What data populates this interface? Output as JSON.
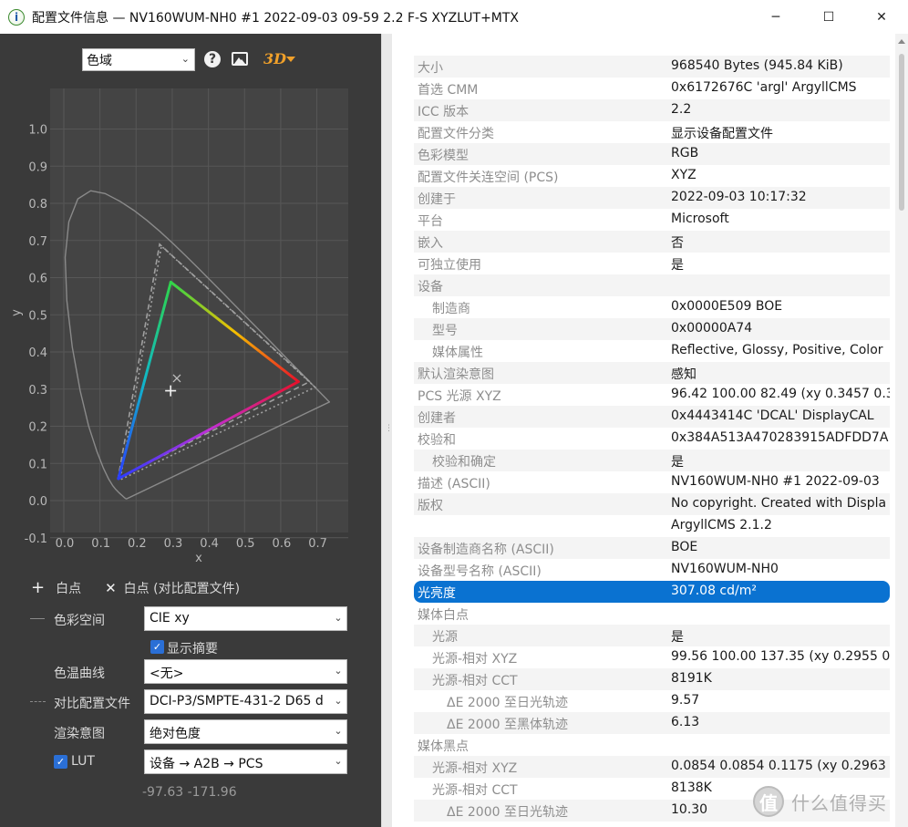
{
  "window": {
    "title": "配置文件信息 — NV160WUM-NH0 #1 2022-09-03 09-59 2.2 F-S XYZLUT+MTX",
    "app_icon": "info-icon",
    "controls": {
      "minimize": "─",
      "maximize": "☐",
      "close": "✕"
    }
  },
  "toolbar": {
    "view_select": "色域",
    "help_icon": "?",
    "threed_label": "3D"
  },
  "chart_data": {
    "type": "scatter",
    "title": "",
    "xlabel": "x",
    "ylabel": "y",
    "xlim": [
      -0.05,
      0.78
    ],
    "ylim": [
      -0.15,
      1.02
    ],
    "xticks": [
      "0.0",
      "0.1",
      "0.2",
      "0.3",
      "0.4",
      "0.5",
      "0.6",
      "0.7"
    ],
    "xtick_values": [
      0.0,
      0.1,
      0.2,
      0.3,
      0.4,
      0.5,
      0.6,
      0.7
    ],
    "yticks": [
      "1.0",
      "0.9",
      "0.8",
      "0.7",
      "0.6",
      "0.5",
      "0.4",
      "0.3",
      "0.2",
      "0.1",
      "0.0",
      "-0.1"
    ],
    "ytick_values": [
      1.0,
      0.9,
      0.8,
      0.7,
      0.6,
      0.5,
      0.4,
      0.3,
      0.2,
      0.1,
      0.0,
      -0.1
    ],
    "grid": true,
    "spectral_locus": [
      [
        0.1741,
        0.005
      ],
      [
        0.1738,
        0.0049
      ],
      [
        0.1736,
        0.0049
      ],
      [
        0.1733,
        0.0048
      ],
      [
        0.173,
        0.0048
      ],
      [
        0.1726,
        0.0048
      ],
      [
        0.1721,
        0.0048
      ],
      [
        0.1714,
        0.0051
      ],
      [
        0.1703,
        0.0058
      ],
      [
        0.1689,
        0.0069
      ],
      [
        0.1669,
        0.0086
      ],
      [
        0.1644,
        0.0109
      ],
      [
        0.1611,
        0.0138
      ],
      [
        0.1566,
        0.0177
      ],
      [
        0.151,
        0.0227
      ],
      [
        0.144,
        0.0297
      ],
      [
        0.1355,
        0.0399
      ],
      [
        0.1241,
        0.0578
      ],
      [
        0.1096,
        0.0868
      ],
      [
        0.0913,
        0.1327
      ],
      [
        0.0687,
        0.2007
      ],
      [
        0.0454,
        0.295
      ],
      [
        0.0235,
        0.4127
      ],
      [
        0.0082,
        0.5384
      ],
      [
        0.0039,
        0.6548
      ],
      [
        0.0139,
        0.7502
      ],
      [
        0.0389,
        0.812
      ],
      [
        0.0743,
        0.8338
      ],
      [
        0.1142,
        0.8262
      ],
      [
        0.1547,
        0.8059
      ],
      [
        0.1929,
        0.7816
      ],
      [
        0.2296,
        0.7543
      ],
      [
        0.2658,
        0.7243
      ],
      [
        0.3016,
        0.6923
      ],
      [
        0.3373,
        0.6589
      ],
      [
        0.3731,
        0.6245
      ],
      [
        0.4087,
        0.5896
      ],
      [
        0.4441,
        0.5547
      ],
      [
        0.4788,
        0.5202
      ],
      [
        0.5125,
        0.4866
      ],
      [
        0.5448,
        0.4544
      ],
      [
        0.5752,
        0.4242
      ],
      [
        0.6029,
        0.3965
      ],
      [
        0.627,
        0.3725
      ],
      [
        0.6482,
        0.3514
      ],
      [
        0.6658,
        0.334
      ],
      [
        0.6801,
        0.3197
      ],
      [
        0.6915,
        0.3083
      ],
      [
        0.7006,
        0.2993
      ],
      [
        0.7079,
        0.292
      ],
      [
        0.714,
        0.2859
      ],
      [
        0.719,
        0.2809
      ],
      [
        0.723,
        0.277
      ],
      [
        0.726,
        0.274
      ],
      [
        0.7283,
        0.2717
      ],
      [
        0.73,
        0.27
      ],
      [
        0.7311,
        0.2689
      ],
      [
        0.732,
        0.268
      ],
      [
        0.7327,
        0.2673
      ],
      [
        0.7334,
        0.2666
      ],
      [
        0.734,
        0.266
      ],
      [
        0.7344,
        0.2656
      ],
      [
        0.7346,
        0.2654
      ],
      [
        0.7347,
        0.2653
      ]
    ],
    "series": [
      {
        "name": "",
        "kind": "profile-gamut",
        "style": "gradient-solid",
        "points": [
          [
            0.649,
            0.32
          ],
          [
            0.296,
            0.588
          ],
          [
            0.151,
            0.059
          ]
        ]
      },
      {
        "name": "",
        "kind": "reference-gamut",
        "style": "dashed",
        "points": [
          [
            0.68,
            0.32
          ],
          [
            0.265,
            0.69
          ],
          [
            0.15,
            0.06
          ]
        ]
      },
      {
        "name": "",
        "kind": "reference-gamut-outline",
        "style": "dotted",
        "points": [
          [
            0.695,
            0.305
          ],
          [
            0.27,
            0.685
          ],
          [
            0.156,
            0.056
          ]
        ]
      }
    ],
    "whitepoint": {
      "x": 0.2955,
      "y": 0.2955
    },
    "reference_whitepoint": {
      "x": 0.3127,
      "y": 0.329
    }
  },
  "legend": {
    "whitepoint_label": "白点",
    "ref_whitepoint_label": "白点 (对比配置文件)"
  },
  "controls": {
    "colorspace_label": "色彩空间",
    "colorspace_value": "CIE xy",
    "show_summary_label": "显示摘要",
    "cct_label": "色温曲线",
    "cct_value": "<无>",
    "compare_label": "对比配置文件",
    "compare_value": "DCI-P3/SMPTE-431-2 D65 d",
    "intent_label": "渲染意图",
    "intent_value": "绝对色度",
    "lut_label": "LUT",
    "lut_value": "设备 → A2B → PCS",
    "cursor_coords": "-97.63 -171.96"
  },
  "info_rows": [
    {
      "key": "大小",
      "value": "968540 Bytes (945.84 KiB)",
      "indent": 0
    },
    {
      "key": "首选 CMM",
      "value": "0x6172676C 'argl' ArgyllCMS",
      "indent": 0
    },
    {
      "key": "ICC 版本",
      "value": "2.2",
      "indent": 0
    },
    {
      "key": "配置文件分类",
      "value": "显示设备配置文件",
      "indent": 0
    },
    {
      "key": "色彩模型",
      "value": "RGB",
      "indent": 0
    },
    {
      "key": "配置文件关连空间 (PCS)",
      "value": "XYZ",
      "indent": 0
    },
    {
      "key": "创建于",
      "value": "2022-09-03 10:17:32",
      "indent": 0
    },
    {
      "key": "平台",
      "value": "Microsoft",
      "indent": 0
    },
    {
      "key": "嵌入",
      "value": "否",
      "indent": 0
    },
    {
      "key": "可独立使用",
      "value": "是",
      "indent": 0
    },
    {
      "key": "设备",
      "value": "",
      "indent": 0
    },
    {
      "key": "制造商",
      "value": "0x0000E509 BOE",
      "indent": 1
    },
    {
      "key": "型号",
      "value": "0x00000A74",
      "indent": 1
    },
    {
      "key": "媒体属性",
      "value": "Reflective, Glossy, Positive, Color",
      "indent": 1
    },
    {
      "key": "默认渲染意图",
      "value": "感知",
      "indent": 0
    },
    {
      "key": "PCS 光源 XYZ",
      "value": "96.42 100.00  82.49 (xy 0.3457 0.3",
      "indent": 0
    },
    {
      "key": "创建者",
      "value": "0x4443414C 'DCAL' DisplayCAL",
      "indent": 0
    },
    {
      "key": "校验和",
      "value": "0x384A513A470283915ADFDD7A",
      "indent": 0
    },
    {
      "key": "校验和确定",
      "value": "是",
      "indent": 1
    },
    {
      "key": "描述 (ASCII)",
      "value": "NV160WUM-NH0 #1 2022-09-03",
      "indent": 0
    },
    {
      "key": "版权",
      "value": "No copyright. Created with Displa",
      "indent": 0
    },
    {
      "key": "",
      "value": "ArgyllCMS 2.1.2",
      "indent": 0
    },
    {
      "key": "设备制造商名称 (ASCII)",
      "value": "BOE",
      "indent": 0
    },
    {
      "key": "设备型号名称 (ASCII)",
      "value": "NV160WUM-NH0",
      "indent": 0
    },
    {
      "key": "光亮度",
      "value": "307.08 cd/m²",
      "indent": 0,
      "selected": true
    },
    {
      "key": "媒体白点",
      "value": "",
      "indent": 0
    },
    {
      "key": "光源",
      "value": "是",
      "indent": 1
    },
    {
      "key": "光源-相对 XYZ",
      "value": "99.56 100.00 137.35 (xy 0.2955 0.",
      "indent": 1
    },
    {
      "key": "光源-相对 CCT",
      "value": "8191K",
      "indent": 1
    },
    {
      "key": "ΔE 2000 至日光轨迹",
      "value": "9.57",
      "indent": 2
    },
    {
      "key": "ΔE 2000 至黑体轨迹",
      "value": "6.13",
      "indent": 2
    },
    {
      "key": "媒体黑点",
      "value": "",
      "indent": 0
    },
    {
      "key": "光源-相对 XYZ",
      "value": "0.0854 0.0854 0.1175 (xy 0.2963 0",
      "indent": 1
    },
    {
      "key": "光源-相对 CCT",
      "value": "8138K",
      "indent": 1
    },
    {
      "key": "ΔE 2000 至日光轨迹",
      "value": "10.30",
      "indent": 2
    }
  ],
  "watermark": {
    "logo": "值",
    "text": "什么值得买"
  },
  "colors": {
    "panel_bg": "#3a3a3a",
    "selection": "#0a72d1",
    "accent": "#f0a02a"
  }
}
